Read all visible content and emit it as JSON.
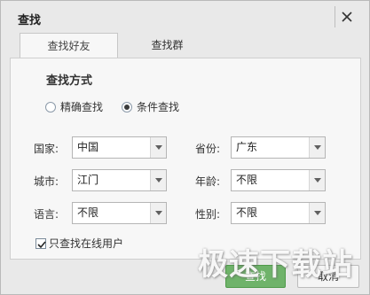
{
  "dialog": {
    "title": "查找",
    "tabs": [
      {
        "label": "查找好友",
        "active": true
      },
      {
        "label": "查找群",
        "active": false
      }
    ]
  },
  "search_method": {
    "heading": "查找方式",
    "options": [
      {
        "label": "精确查找",
        "checked": false
      },
      {
        "label": "条件查找",
        "checked": true
      }
    ]
  },
  "filters": {
    "country": {
      "label": "国家:",
      "value": "中国"
    },
    "province": {
      "label": "省份:",
      "value": "广东"
    },
    "city": {
      "label": "城市:",
      "value": "江门"
    },
    "age": {
      "label": "年龄:",
      "value": "不限"
    },
    "language": {
      "label": "语言:",
      "value": "不限"
    },
    "gender": {
      "label": "性别:",
      "value": "不限"
    }
  },
  "online_only": {
    "label": "只查找在线用户",
    "checked": true
  },
  "buttons": {
    "search": "查找",
    "cancel": "取消"
  },
  "watermark": "极速下载站",
  "colors": {
    "search_button": "#6fb36a",
    "panel": "#f7f7f7",
    "frame": "#e9e9e9"
  }
}
